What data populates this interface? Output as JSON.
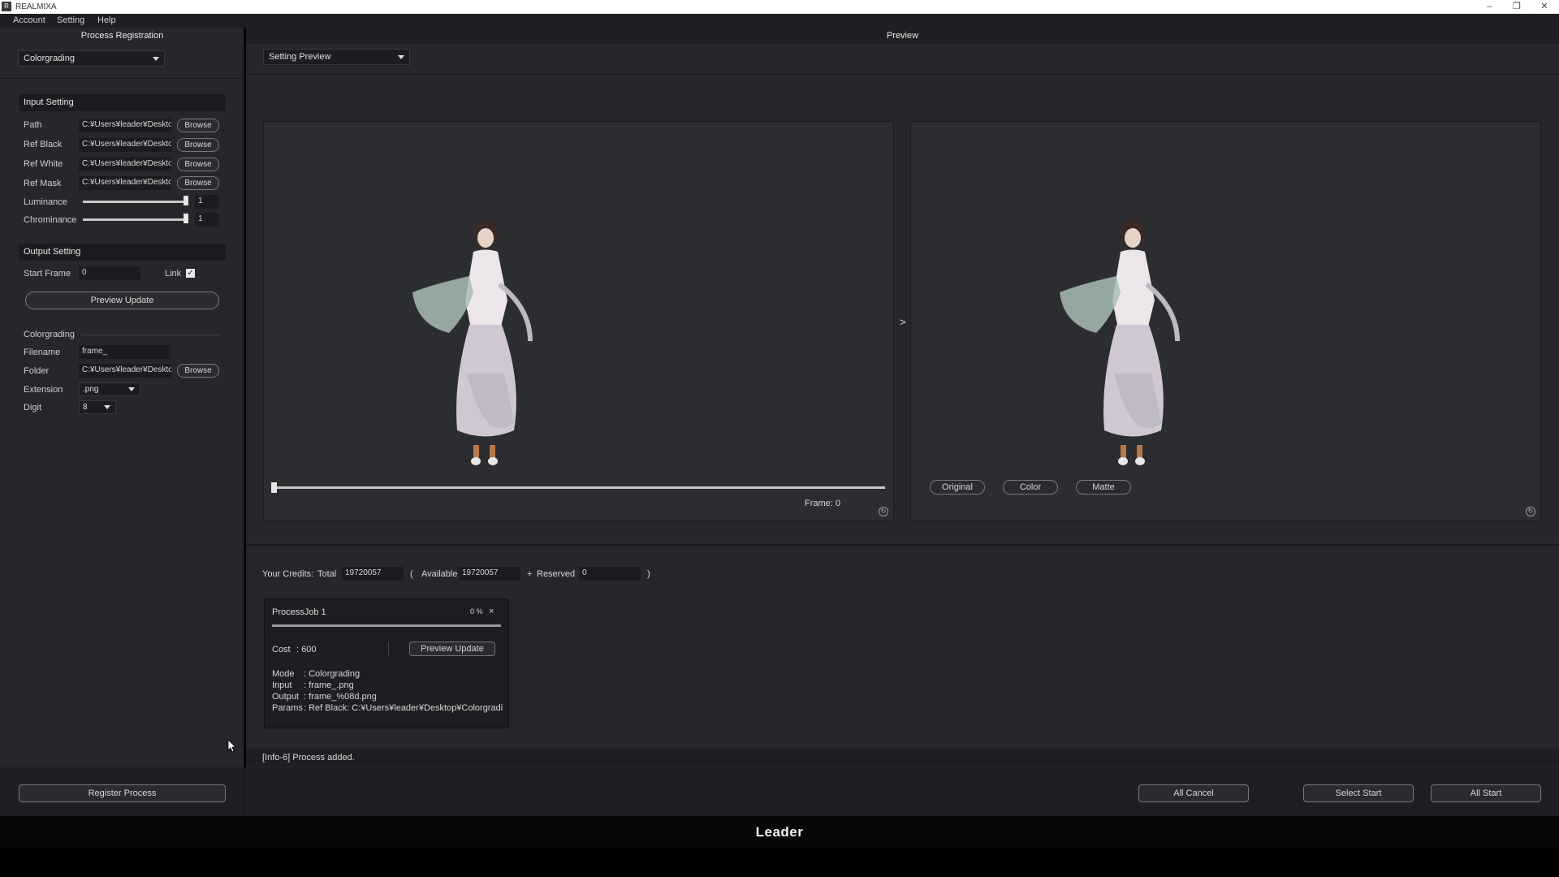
{
  "window": {
    "title": "REALMIXA",
    "minimize": "–",
    "restore": "❐",
    "close": "✕"
  },
  "menu": [
    "Account",
    "Setting",
    "Help"
  ],
  "left": {
    "title": "Process Registration",
    "mode_select": "Colorgrading",
    "input_setting": {
      "header": "Input Setting",
      "rows": [
        {
          "label": "Path",
          "value": "C:¥Users¥leader¥Deskto",
          "button": "Browse"
        },
        {
          "label": "Ref Black",
          "value": "C:¥Users¥leader¥Deskto",
          "button": "Browse"
        },
        {
          "label": "Ref White",
          "value": "C:¥Users¥leader¥Deskto",
          "button": "Browse"
        },
        {
          "label": "Ref Mask",
          "value": "C:¥Users¥leader¥Deskto",
          "button": "Browse"
        }
      ],
      "luminance": {
        "label": "Luminance",
        "value": "1",
        "level": 1.0
      },
      "chrominance": {
        "label": "Chrominance",
        "value": "1",
        "level": 1.0
      }
    },
    "output_setting": {
      "header": "Output Setting",
      "start_frame_label": "Start Frame",
      "start_frame_value": "0",
      "link_label": "Link",
      "link_checked": true,
      "preview_update": "Preview Update",
      "colorgrading_label": "Colorgrading",
      "filename_label": "Filename",
      "filename_value": "frame_",
      "folder_label": "Folder",
      "folder_value": "C:¥Users¥leader¥Deskto",
      "folder_button": "Browse",
      "extension_label": "Extension",
      "extension_value": ".png",
      "digit_label": "Digit",
      "digit_value": "8"
    },
    "register_button": "Register Process"
  },
  "preview": {
    "title": "Preview",
    "setting_select": "Setting Preview",
    "arrow": ">",
    "frame_label": "Frame:",
    "frame_value": "0",
    "seek_level": 0.0,
    "view_buttons": [
      "Original",
      "Color",
      "Matte"
    ]
  },
  "credits": {
    "label": "Your Credits:",
    "total_label": "Total",
    "total_value": "19720057",
    "open_paren": "(",
    "available_label": "Available",
    "available_value": "19720057",
    "plus": "+",
    "reserved_label": "Reserved",
    "reserved_value": "0",
    "close_paren": ")"
  },
  "job": {
    "title": "ProcessJob 1",
    "percent": "0 %",
    "close": "×",
    "progress": 0.0,
    "cost_label": "Cost",
    "cost_value": ": 600",
    "preview_update": "Preview Update",
    "details": [
      {
        "k": "Mode",
        "v": ": Colorgrading"
      },
      {
        "k": "Input",
        "v": ": frame_.png"
      },
      {
        "k": "Output",
        "v": ": frame_%08d.png"
      },
      {
        "k": "Params",
        "v": ": Ref Black: C:¥Users¥leader¥Desktop¥Colorgrading¥I."
      }
    ]
  },
  "status": "[Info-6] Process added.",
  "actions": {
    "all_cancel": "All Cancel",
    "select_start": "Select Start",
    "all_start": "All Start"
  },
  "brand": "Leader"
}
